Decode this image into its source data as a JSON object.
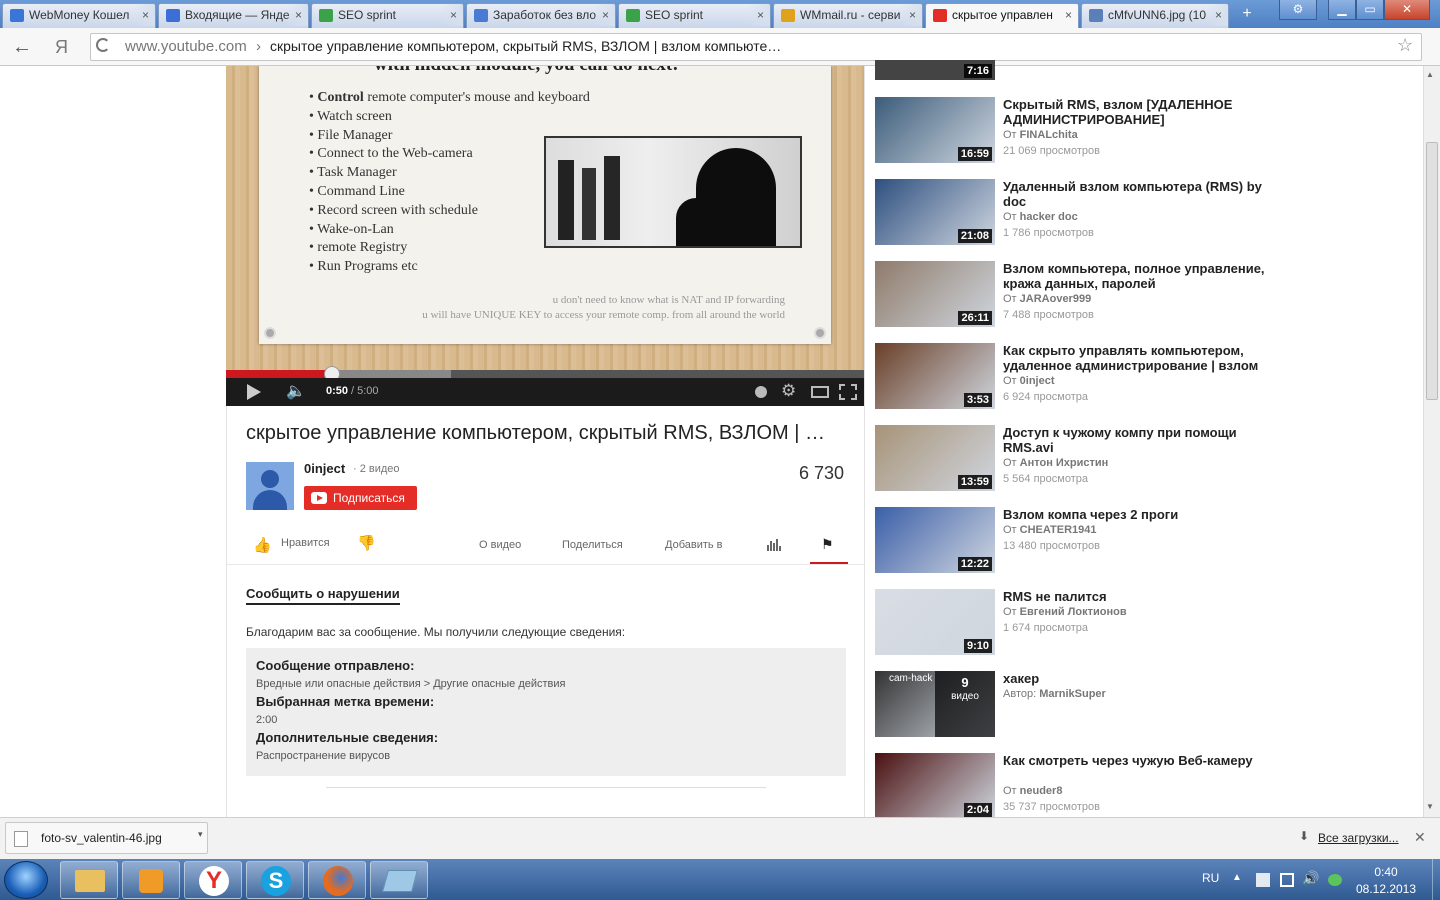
{
  "browser": {
    "tabs": [
      {
        "label": "WebMoney Кошел",
        "color": "#3a76d8"
      },
      {
        "label": "Входящие — Янде",
        "color": "#3c6fd6"
      },
      {
        "label": "SEO sprint",
        "color": "#3aa34a"
      },
      {
        "label": "Заработок без вло",
        "color": "#4a7bd4"
      },
      {
        "label": "SEO sprint",
        "color": "#3aa34a"
      },
      {
        "label": "WMmail.ru - серви",
        "color": "#e0a11b"
      },
      {
        "label": "скрытое управлен",
        "color": "#e52d27"
      },
      {
        "label": "cMfvUNN6.jpg (10",
        "color": "#5b7fb8"
      }
    ],
    "back_glyph": "←",
    "yandex_glyph": "Я",
    "address_domain": "www.youtube.com",
    "address_sep": "›",
    "address_title": "скрытое управление компьютером, скрытый RMS, ВЗЛОМ | взлом компьюте…"
  },
  "player": {
    "slide_heading": "with hidden module, you can do next:",
    "bullets": [
      {
        "bold": "Control",
        "rest": " remote computer's mouse and keyboard"
      },
      {
        "bold": "",
        "rest": "Watch screen"
      },
      {
        "bold": "",
        "rest": "File Manager"
      },
      {
        "bold": "",
        "rest": "Connect to the Web-camera"
      },
      {
        "bold": "",
        "rest": "Task Manager"
      },
      {
        "bold": "",
        "rest": "Command Line"
      },
      {
        "bold": "",
        "rest": "Record screen with schedule"
      },
      {
        "bold": "",
        "rest": "Wake-on-Lan"
      },
      {
        "bold": "",
        "rest": "remote Registry"
      },
      {
        "bold": "",
        "rest": "Run Programs etc"
      }
    ],
    "footnote1": "u don't need to know what is NAT and IP forwarding",
    "footnote2": "u will have UNIQUE KEY to access your remote comp. from all around the world",
    "current_time": "0:50",
    "duration": " / 5:00",
    "progress_fraction": 0.1667,
    "buffered_fraction": 0.352
  },
  "video": {
    "title": "скрытое управление компьютером, скрытый RMS, ВЗЛОМ | …",
    "channel": "0inject",
    "video_count": "· 2 видео",
    "subscribe_label": "Подписаться",
    "views": "6 730",
    "like_label": "Нравится",
    "tabs": [
      "О видео",
      "Поделиться",
      "Добавить в"
    ]
  },
  "report": {
    "heading": "Сообщить о нарушении",
    "thanks": "Благодарим вас за сообщение. Мы получили следующие сведения:",
    "fields": [
      {
        "label": "Сообщение отправлено:",
        "value": "Вредные или опасные действия > Другие опасные действия"
      },
      {
        "label": "Выбранная метка времени:",
        "value": "2:00"
      },
      {
        "label": "Дополнительные сведения:",
        "value": "Распространение вирусов"
      }
    ]
  },
  "sidebar": {
    "top_partial_duration": "7:16",
    "videos": [
      {
        "title": "Скрытый RMS, взлом [УДАЛЕННОЕ АДМИНИСТРИРОВАНИЕ]",
        "by_prefix": "От ",
        "author": "FINALchita",
        "views": "21 069 просмотров",
        "duration": "16:59",
        "thumb": "#3b5c7a"
      },
      {
        "title": "Удаленный взлом компьютера (RMS) by doc",
        "by_prefix": "От ",
        "author": "hacker doc",
        "views": "1 786 просмотров",
        "duration": "21:08",
        "thumb": "#2d4f7f"
      },
      {
        "title": "Взлом компьютера, полное управление, кража данных, паролей",
        "by_prefix": "От ",
        "author": "JARAover999",
        "views": "7 488 просмотров",
        "duration": "26:11",
        "thumb": "#8f7b6a"
      },
      {
        "title": "Как скрыто управлять компьютером, удаленное администрирование | взлом",
        "by_prefix": "От ",
        "author": "0inject",
        "views": "6 924 просмотра",
        "duration": "3:53",
        "thumb": "#6a3f27"
      },
      {
        "title": "Доступ к чужому компу при помощи RMS.avi",
        "by_prefix": "От ",
        "author": "Антон Ихристин",
        "views": "5 564 просмотра",
        "duration": "13:59",
        "thumb": "#a79378"
      },
      {
        "title": "Взлом компа через 2 проги",
        "by_prefix": "От ",
        "author": "CHEATER1941",
        "views": "13 480 просмотров",
        "duration": "12:22",
        "thumb": "#3a5ea8"
      },
      {
        "title": "RMS не палится",
        "by_prefix": "От ",
        "author": "Евгений Локтионов",
        "views": "1 674 просмотра",
        "duration": "9:10",
        "thumb": "#d9dde4"
      },
      {
        "title": "хакер",
        "by_prefix": "Автор: ",
        "author": "MarnikSuper",
        "views": "",
        "duration": "",
        "thumb": "#333333",
        "playlist_count": "9",
        "playlist_label": "видео",
        "thumb_caption": "cam-hack"
      },
      {
        "title": "Как смотреть через чужую Веб-камеру",
        "by_prefix": "От ",
        "author": "neuder8",
        "views": "35 737 просмотров",
        "duration": "2:04",
        "thumb": "#4a1010"
      }
    ]
  },
  "downloads": {
    "file": "foto-sv_valentin-46.jpg",
    "all_label": "Все загрузки..."
  },
  "taskbar": {
    "lang": "RU",
    "time": "0:40",
    "date": "08.12.2013"
  },
  "colors": {
    "accent_red": "#e52d27",
    "link_blue": "#2a5db0"
  }
}
